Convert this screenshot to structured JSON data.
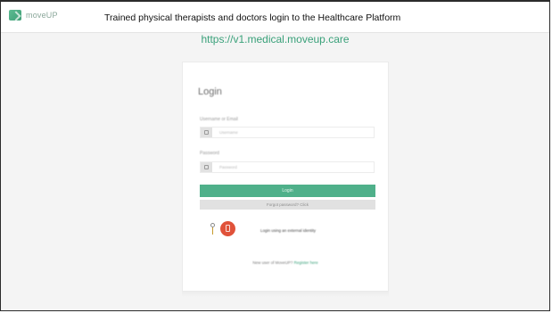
{
  "header": {
    "logo_text": "moveUP",
    "caption": "Trained physical therapists and doctors login to the Healthcare Platform",
    "url": "https://v1.medical.moveup.care"
  },
  "login": {
    "title": "Login",
    "username_label": "Username or Email",
    "username_placeholder": "Username",
    "password_label": "Password",
    "password_placeholder": "Password",
    "login_button": "Login",
    "forgot_button": "Forgot password? Click",
    "social_text": "Login using an external identity",
    "footer_prefix": "New user of MoveUP?",
    "footer_link": "Register here"
  },
  "colors": {
    "brand": "#4fb08a",
    "link": "#3aa17a",
    "social_red": "#e0523a"
  },
  "icons": {
    "logo": "moveup-logo-icon",
    "user": "user-icon",
    "lock": "lock-icon",
    "key": "key-icon",
    "shield": "shield-icon"
  }
}
